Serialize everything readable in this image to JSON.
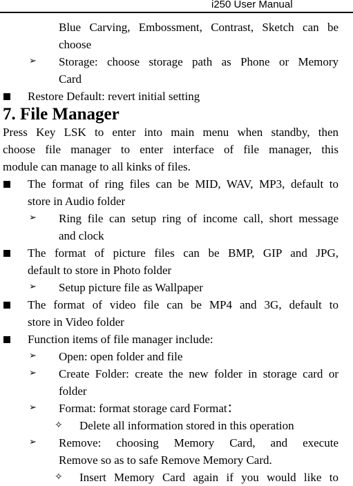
{
  "header": {
    "title": "i250 User Manual"
  },
  "blocks": {
    "b0": {
      "lines": [
        "Blue Carving, Embossment, Contrast, Sketch can be",
        "choose"
      ]
    },
    "b1": {
      "lines": [
        "Storage: choose storage path as Phone or Memory",
        "Card"
      ]
    },
    "b2": {
      "lines": [
        "Restore Default: revert initial setting"
      ]
    },
    "heading": "7. File Manager",
    "intro": {
      "lines": [
        "Press Key LSK to enter into main menu when standby, then",
        "choose file manager to enter interface of file manager, this",
        "module can manage to all kinks of files."
      ]
    },
    "ring": {
      "lines": [
        "The format of ring files can be MID, WAV, MP3, default to",
        "store in Audio folder"
      ]
    },
    "ring_sub": {
      "lines": [
        "Ring file can setup ring of income call, short message",
        "and clock"
      ]
    },
    "picture": {
      "lines": [
        "The format of picture files can be BMP, GIP and JPG,",
        "default to store in Photo folder"
      ]
    },
    "picture_sub": {
      "lines": [
        "Setup picture file as Wallpaper"
      ]
    },
    "video": {
      "lines": [
        "The format of video file can be MP4 and 3G, default to",
        "store in Video folder"
      ]
    },
    "functions": {
      "lines": [
        "Function items of file manager include:"
      ]
    },
    "open": {
      "lines": [
        "Open: open folder and file"
      ]
    },
    "create": {
      "lines": [
        "Create Folder: create the new folder in storage card or",
        "folder"
      ]
    },
    "format": {
      "lines": [
        "Format: format storage card Format："
      ]
    },
    "format_sub": {
      "lines": [
        "Delete all information stored in this operation"
      ]
    },
    "remove": {
      "lines": [
        "Remove: choosing Memory Card, and execute",
        "Remove so as to safe Remove Memory Card."
      ]
    },
    "remove_sub": {
      "lines": [
        "Insert Memory Card again if you would like to"
      ]
    }
  },
  "icons": {
    "square_bullet": "■",
    "arrow_bullet": "➢",
    "diamond_bullet": "✧"
  }
}
